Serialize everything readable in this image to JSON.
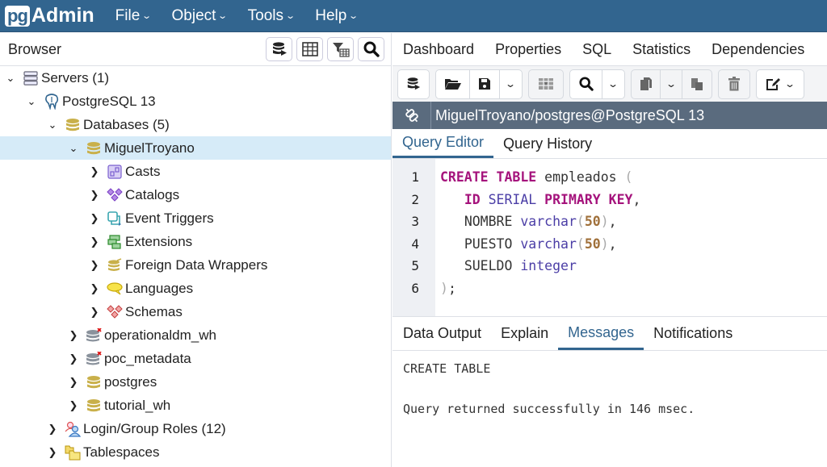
{
  "app": {
    "logo_pg": "pg",
    "logo_admin": "Admin",
    "menu": [
      {
        "label": "File"
      },
      {
        "label": "Object"
      },
      {
        "label": "Tools"
      },
      {
        "label": "Help"
      }
    ]
  },
  "browser": {
    "title": "Browser",
    "tools": [
      {
        "icon": "query-tool-icon"
      },
      {
        "icon": "view-data-icon"
      },
      {
        "icon": "filtered-rows-icon"
      },
      {
        "icon": "search-objects-icon"
      }
    ],
    "tree": [
      {
        "label": "Servers (1)",
        "icon": "servers-icon",
        "expanded": true
      },
      {
        "label": "PostgreSQL 13",
        "icon": "postgresql-elephant-icon",
        "expanded": true
      },
      {
        "label": "Databases (5)",
        "icon": "databases-icon",
        "expanded": true
      },
      {
        "label": "MiguelTroyano",
        "icon": "database-icon",
        "expanded": true,
        "selected": true
      },
      {
        "label": "Casts",
        "icon": "casts-icon",
        "expanded": false
      },
      {
        "label": "Catalogs",
        "icon": "catalogs-icon",
        "expanded": false
      },
      {
        "label": "Event Triggers",
        "icon": "event-triggers-icon",
        "expanded": false
      },
      {
        "label": "Extensions",
        "icon": "extensions-icon",
        "expanded": false
      },
      {
        "label": "Foreign Data Wrappers",
        "icon": "foreign-data-wrappers-icon",
        "expanded": false
      },
      {
        "label": "Languages",
        "icon": "languages-icon",
        "expanded": false
      },
      {
        "label": "Schemas",
        "icon": "schemas-icon",
        "expanded": false
      },
      {
        "label": "operationaldm_wh",
        "icon": "database-disconnected-icon",
        "expanded": false
      },
      {
        "label": "poc_metadata",
        "icon": "database-disconnected-icon",
        "expanded": false
      },
      {
        "label": "postgres",
        "icon": "database-icon",
        "expanded": false
      },
      {
        "label": "tutorial_wh",
        "icon": "database-icon",
        "expanded": false
      },
      {
        "label": "Login/Group Roles (12)",
        "icon": "roles-icon",
        "expanded": false
      },
      {
        "label": "Tablespaces",
        "icon": "tablespaces-icon",
        "expanded": false
      }
    ]
  },
  "main_tabs": [
    {
      "label": "Dashboard"
    },
    {
      "label": "Properties"
    },
    {
      "label": "SQL"
    },
    {
      "label": "Statistics"
    },
    {
      "label": "Dependencies"
    }
  ],
  "connection": {
    "label": "MiguelTroyano/postgres@PostgreSQL 13"
  },
  "query_tabs": [
    {
      "label": "Query Editor",
      "active": true
    },
    {
      "label": "Query History",
      "active": false
    }
  ],
  "editor": {
    "line_numbers": [
      "1",
      "2",
      "3",
      "4",
      "5",
      "6"
    ],
    "lines": [
      "CREATE TABLE empleados (",
      "   ID SERIAL PRIMARY KEY,",
      "   NOMBRE varchar(50),",
      "   PUESTO varchar(50),",
      "   SUELDO integer",
      ");"
    ],
    "tokens": {
      "l1": [
        "CREATE",
        "TABLE",
        "empleados",
        "("
      ],
      "l2": [
        "ID",
        "SERIAL",
        "PRIMARY KEY",
        ","
      ],
      "l3": [
        "NOMBRE",
        "varchar",
        "(",
        "50",
        ")",
        ","
      ],
      "l4": [
        "PUESTO",
        "varchar",
        "(",
        "50",
        ")",
        ","
      ],
      "l5": [
        "SUELDO",
        "integer"
      ],
      "l6": [
        ")",
        ";"
      ]
    }
  },
  "result_tabs": [
    {
      "label": "Data Output",
      "active": false
    },
    {
      "label": "Explain",
      "active": false
    },
    {
      "label": "Messages",
      "active": true
    },
    {
      "label": "Notifications",
      "active": false
    }
  ],
  "messages": [
    "CREATE TABLE",
    "",
    "Query returned successfully in 146 msec."
  ],
  "colors": {
    "brand": "#32658f",
    "selected_row": "#d6ebf8",
    "connection_bar": "#5a6b7e",
    "keyword": "#a5137c",
    "type": "#4b3ea6",
    "number": "#a0703a"
  }
}
